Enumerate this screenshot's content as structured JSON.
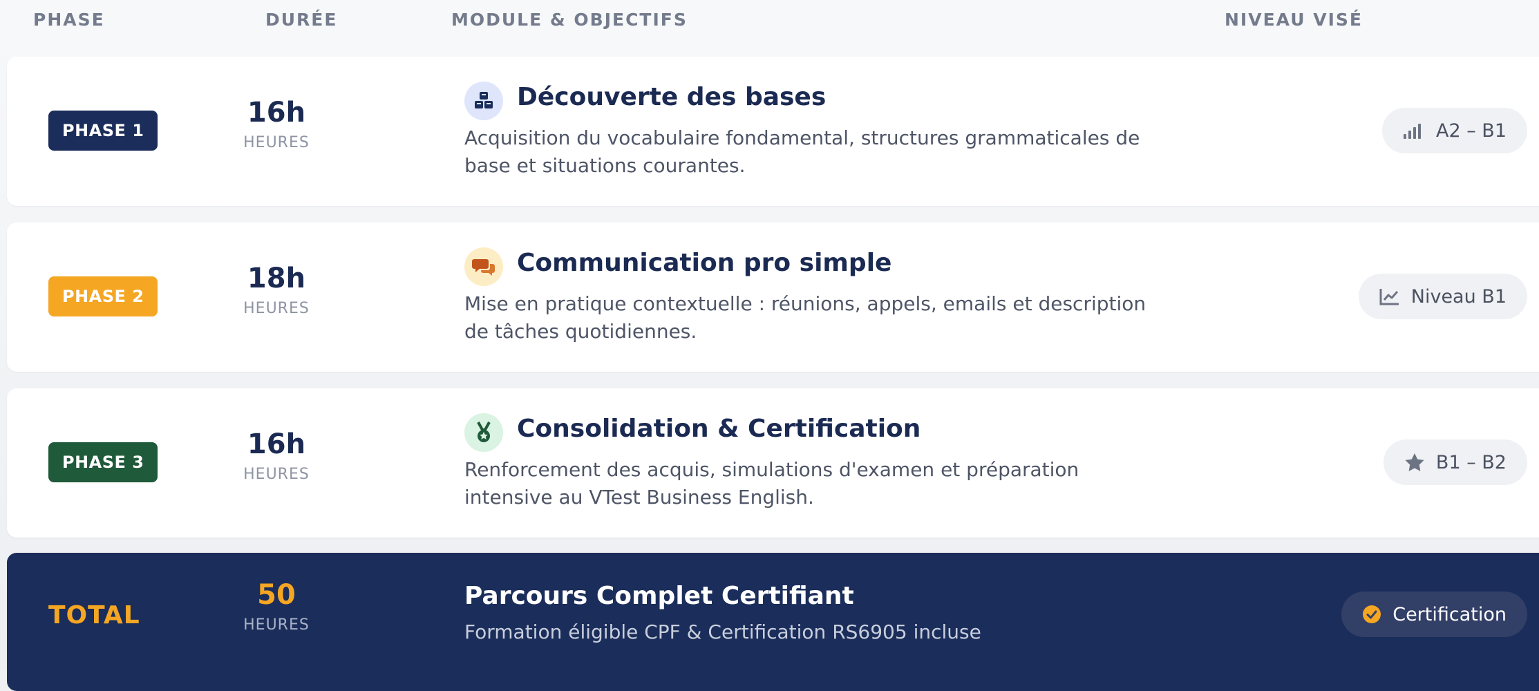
{
  "header": {
    "phase": "PHASE",
    "duree": "DURÉE",
    "module": "MODULE & OBJECTIFS",
    "niveau": "NIVEAU VISÉ"
  },
  "phases": [
    {
      "badge": "PHASE 1",
      "badge_color": "#1b2d5a",
      "hours": "16h",
      "unit": "HEURES",
      "icon": "cubes-icon",
      "icon_bg": "#dfe6fb",
      "title": "Découverte des bases",
      "description": "Acquisition du vocabulaire fondamental, structures grammaticales de base et situations courantes.",
      "level_icon": "signal-bars-icon",
      "level": "A2 – B1"
    },
    {
      "badge": "PHASE 2",
      "badge_color": "#f5a623",
      "hours": "18h",
      "unit": "HEURES",
      "icon": "chat-bubbles-icon",
      "icon_bg": "#fdedc4",
      "title": "Communication pro simple",
      "description": "Mise en pratique contextuelle : réunions, appels, emails et description de tâches quotidiennes.",
      "level_icon": "line-chart-icon",
      "level": "Niveau B1"
    },
    {
      "badge": "PHASE 3",
      "badge_color": "#1f5a3a",
      "hours": "16h",
      "unit": "HEURES",
      "icon": "medal-icon",
      "icon_bg": "#daf3e2",
      "title": "Consolidation & Certification",
      "description": "Renforcement des acquis, simulations d'examen et préparation intensive au VTest Business English.",
      "level_icon": "star-icon",
      "level": "B1 – B2"
    }
  ],
  "total": {
    "label": "TOTAL",
    "hours": "50",
    "unit": "HEURES",
    "title": "Parcours Complet Certifiant",
    "description": "Formation éligible CPF & Certification RS6905 incluse",
    "badge_icon": "check-circle-icon",
    "badge": "Certification"
  }
}
